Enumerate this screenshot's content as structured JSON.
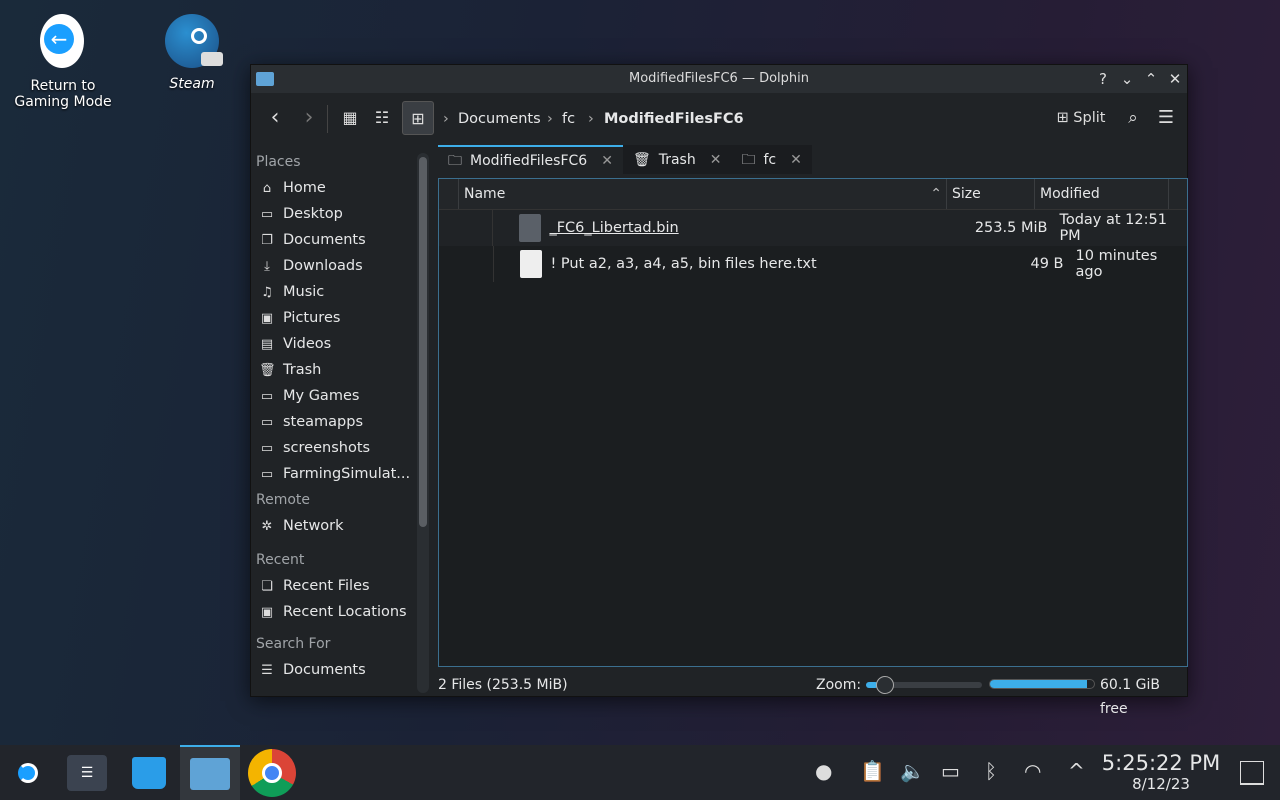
{
  "desktop": {
    "icons": [
      {
        "label": "Return to Gaming Mode",
        "line1": "Return to",
        "line2": "Gaming Mode"
      },
      {
        "label": "Steam"
      }
    ]
  },
  "window": {
    "title": "ModifiedFilesFC6 — Dolphin",
    "help": "?",
    "minimize": "⌄",
    "maximize": "⌃",
    "close": "✕"
  },
  "toolbar": {
    "breadcrumb": [
      "Documents",
      "fc",
      "ModifiedFilesFC6"
    ],
    "split_label": "Split"
  },
  "sidebar": {
    "places_label": "Places",
    "places": [
      {
        "label": "Home",
        "icon": "home-icon"
      },
      {
        "label": "Desktop",
        "icon": "desktop-icon"
      },
      {
        "label": "Documents",
        "icon": "documents-icon"
      },
      {
        "label": "Downloads",
        "icon": "download-icon"
      },
      {
        "label": "Music",
        "icon": "music-icon"
      },
      {
        "label": "Pictures",
        "icon": "pictures-icon"
      },
      {
        "label": "Videos",
        "icon": "videos-icon"
      },
      {
        "label": "Trash",
        "icon": "trash-icon"
      },
      {
        "label": "My Games",
        "icon": "folder-icon"
      },
      {
        "label": "steamapps",
        "icon": "folder-icon"
      },
      {
        "label": "screenshots",
        "icon": "folder-icon"
      },
      {
        "label": "FarmingSimulat...",
        "icon": "folder-icon"
      }
    ],
    "remote_label": "Remote",
    "remote": [
      {
        "label": "Network",
        "icon": "network-icon"
      }
    ],
    "recent_label": "Recent",
    "recent": [
      {
        "label": "Recent Files",
        "icon": "recent-files-icon"
      },
      {
        "label": "Recent Locations",
        "icon": "recent-locations-icon"
      }
    ],
    "search_label": "Search For",
    "search": [
      {
        "label": "Documents",
        "icon": "documents-search-icon"
      }
    ]
  },
  "tabs": [
    {
      "label": "ModifiedFilesFC6",
      "active": true
    },
    {
      "label": "Trash"
    },
    {
      "label": "fc"
    }
  ],
  "table": {
    "columns": [
      "Name",
      "Size",
      "Modified"
    ],
    "sort": "Name ascending",
    "rows": [
      {
        "name": "_FC6_Libertad.bin",
        "size": "253.5 MiB",
        "modified": "Today at 12:51 PM",
        "icon": "binary-file-icon"
      },
      {
        "name": "! Put a2, a3, a4, a5, bin files here.txt",
        "size": "49 B",
        "modified": "10 minutes ago",
        "icon": "text-file-icon"
      }
    ]
  },
  "status": {
    "summary": "2 Files (253.5 MiB)",
    "zoom_label": "Zoom:",
    "zoom_level": 0.1,
    "free_space": "60.1 GiB free",
    "used_fraction": 0.93
  },
  "taskbar": {
    "time": "5:25:22 PM",
    "date": "8/12/23"
  },
  "colors": {
    "accent": "#3daee9",
    "window_bg": "#202326",
    "taskbar_bg": "#22252b"
  }
}
